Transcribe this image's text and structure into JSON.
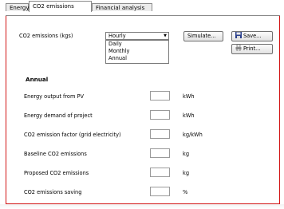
{
  "tabs": [
    {
      "label": "Energy",
      "active": false
    },
    {
      "label": "CO2 emissions",
      "active": true
    },
    {
      "label": "Financial analysis",
      "active": false
    }
  ],
  "emissions": {
    "label": "CO2 emissions (kgs)",
    "selected": "Hourly",
    "options": [
      "Daily",
      "Monthly",
      "Annual"
    ]
  },
  "buttons": {
    "simulate": "Simulate...",
    "save": "Save...",
    "print": "Print..."
  },
  "section_title": "Annual",
  "rows": [
    {
      "label": "Energy output from PV",
      "value": "",
      "unit": "kWh"
    },
    {
      "label": "Energy demand of project",
      "value": "",
      "unit": "kWh"
    },
    {
      "label": "CO2 emission factor (grid electricity)",
      "value": "",
      "unit": "kg/kWh"
    },
    {
      "label": "Baseline CO2 emissions",
      "value": "",
      "unit": "kg"
    },
    {
      "label": "Proposed CO2 emissions",
      "value": "",
      "unit": "kg"
    },
    {
      "label": "CO2 emissions saving",
      "value": "",
      "unit": "%"
    }
  ],
  "colors": {
    "panel_border": "#d21414",
    "tab_bg": "#ececec"
  },
  "icons": {
    "save": "floppy-disk-icon",
    "print": "printer-icon",
    "dropdown": "chevron-down-icon"
  }
}
